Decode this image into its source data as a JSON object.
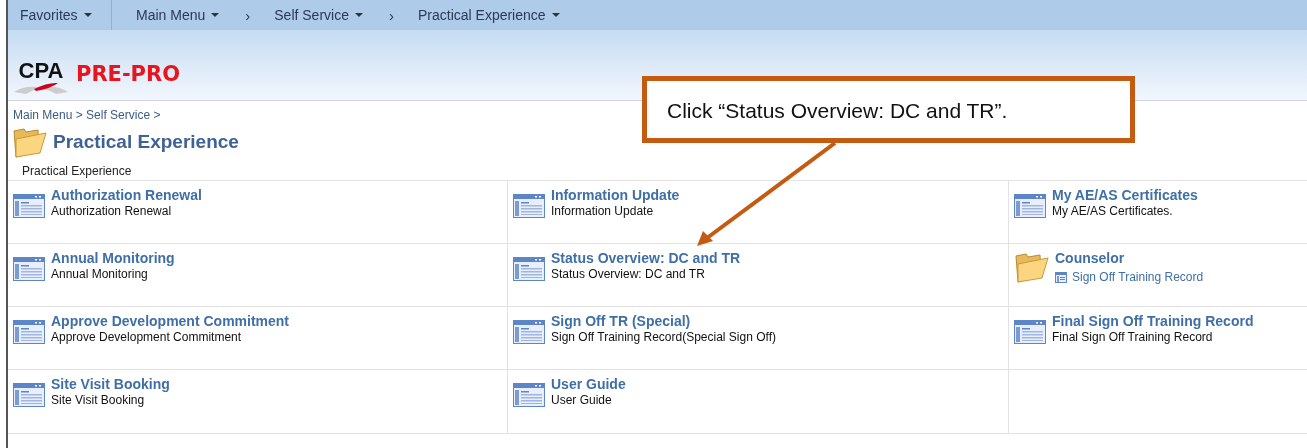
{
  "nav": [
    {
      "kind": "menu",
      "label": "Favorites"
    },
    {
      "kind": "menu",
      "label": "Main Menu"
    },
    {
      "kind": "sep",
      "label": "›"
    },
    {
      "kind": "menu",
      "label": "Self Service"
    },
    {
      "kind": "sep",
      "label": "›"
    },
    {
      "kind": "menu",
      "label": "Practical Experience"
    }
  ],
  "logo": {
    "mark": "CPA",
    "product": "PRE-PRO"
  },
  "breadcrumb": "Main Menu > Self Service >",
  "page_title": "Practical Experience",
  "page_description": "Practical Experience",
  "cells": [
    {
      "kind": "page",
      "title": "Authorization Renewal",
      "description": "Authorization Renewal"
    },
    {
      "kind": "page",
      "title": "Information Update",
      "description": "Information Update"
    },
    {
      "kind": "page",
      "title": "My AE/AS Certificates",
      "description": "My AE/AS Certificates."
    },
    {
      "kind": "page",
      "title": "Annual Monitoring",
      "description": "Annual Monitoring"
    },
    {
      "kind": "page",
      "title": "Status Overview: DC and TR",
      "description": "Status Overview: DC and TR"
    },
    {
      "kind": "folder",
      "title": "Counselor",
      "links": [
        "Sign Off Training Record"
      ]
    },
    {
      "kind": "page",
      "title": "Approve Development Commitment",
      "description": "Approve Development Commitment"
    },
    {
      "kind": "page",
      "title": "Sign Off TR (Special)",
      "description": "Sign Off Training Record(Special Sign Off)"
    },
    {
      "kind": "page",
      "title": "Final Sign Off Training Record",
      "description": "Final Sign Off Training Record"
    },
    {
      "kind": "page",
      "title": "Site Visit Booking",
      "description": "Site Visit Booking"
    },
    {
      "kind": "page",
      "title": "User Guide",
      "description": "User Guide"
    },
    {
      "kind": "empty"
    }
  ],
  "callout": {
    "text": "Click “Status Overview: DC and TR”."
  }
}
